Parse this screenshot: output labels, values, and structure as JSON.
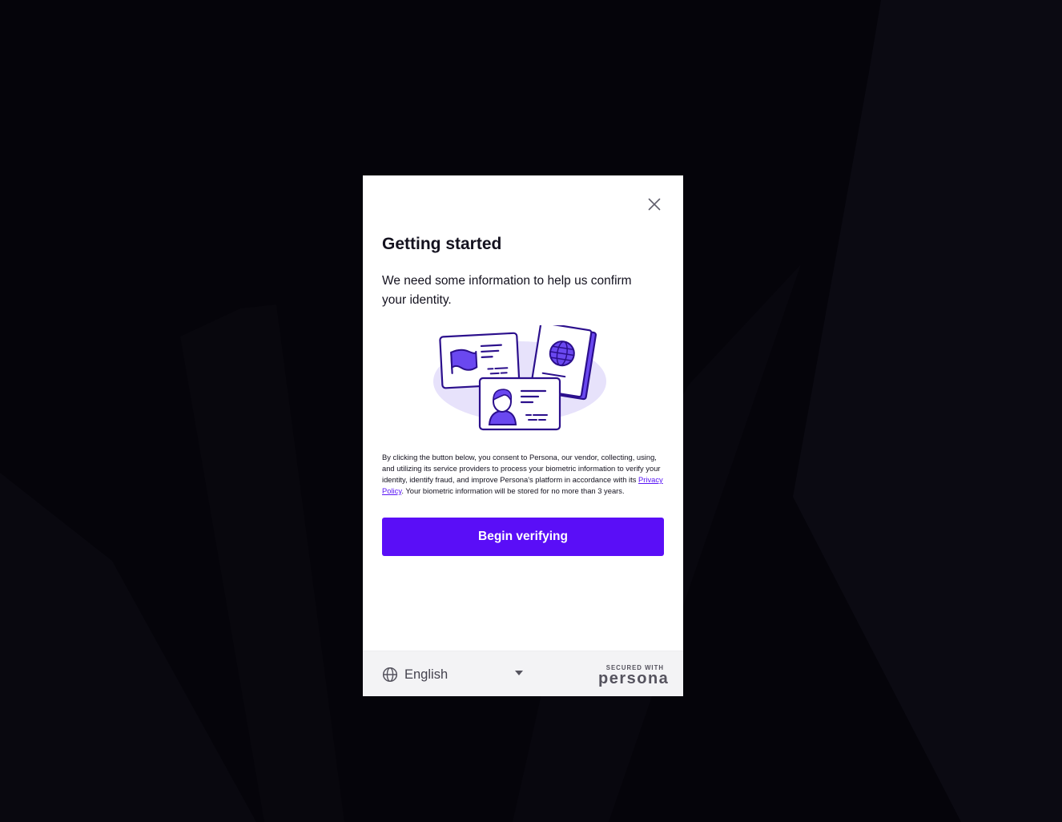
{
  "modal": {
    "close_icon": "close-icon",
    "title": "Getting started",
    "subtitle": "We need some information to help us confirm your identity.",
    "illustration_icon": "id-documents-illustration",
    "consent": {
      "before_link": "By clicking the button below, you consent to Persona, our vendor, collecting, using, and utilizing its service providers to process your biometric information to verify your identity, identify fraud, and improve Persona's platform in accordance with its ",
      "link_text": "Privacy Policy",
      "after_link": ". Your biometric information will be stored for no more than 3 years."
    },
    "begin_button": "Begin verifying"
  },
  "footer": {
    "language_icon": "globe-icon",
    "language": "English",
    "language_caret_icon": "caret-down-icon",
    "secured_label": "SECURED WITH",
    "brand": "persona"
  },
  "colors": {
    "accent": "#5a0ef7",
    "illustration_stroke": "#2b0f8c",
    "illustration_fill": "#6a48f0",
    "illustration_backdrop": "#e7e2fb",
    "page_background": "#05040a"
  }
}
